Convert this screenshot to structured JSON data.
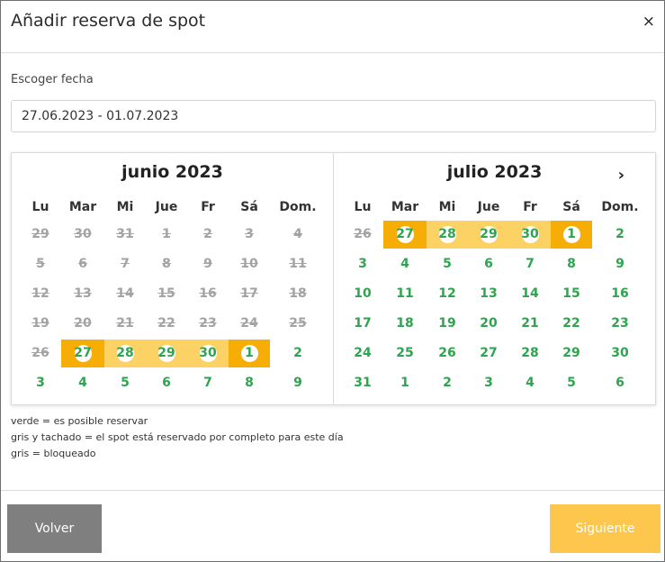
{
  "modal": {
    "title": "Añadir reserva de spot",
    "close_icon": "×"
  },
  "date_field": {
    "label": "Escoger fecha",
    "value": "27.06.2023 - 01.07.2023"
  },
  "calendar": {
    "weekdays": [
      "Lu",
      "Mar",
      "Mi",
      "Jue",
      "Fr",
      "Sá",
      "Dom."
    ],
    "next_icon": "›",
    "colors": {
      "available": "#2ea44f",
      "unavailable": "#a3a3a3",
      "range": "#fdd265",
      "range_end": "#f6ae06"
    },
    "months": [
      {
        "title": "junio 2023",
        "weeks": [
          [
            {
              "d": "29",
              "s": "gray"
            },
            {
              "d": "30",
              "s": "gray"
            },
            {
              "d": "31",
              "s": "gray"
            },
            {
              "d": "1",
              "s": "gray"
            },
            {
              "d": "2",
              "s": "gray"
            },
            {
              "d": "3",
              "s": "gray"
            },
            {
              "d": "4",
              "s": "gray"
            }
          ],
          [
            {
              "d": "5",
              "s": "gray"
            },
            {
              "d": "6",
              "s": "gray"
            },
            {
              "d": "7",
              "s": "gray"
            },
            {
              "d": "8",
              "s": "gray"
            },
            {
              "d": "9",
              "s": "gray"
            },
            {
              "d": "10",
              "s": "gray"
            },
            {
              "d": "11",
              "s": "gray"
            }
          ],
          [
            {
              "d": "12",
              "s": "gray"
            },
            {
              "d": "13",
              "s": "gray"
            },
            {
              "d": "14",
              "s": "gray"
            },
            {
              "d": "15",
              "s": "gray"
            },
            {
              "d": "16",
              "s": "gray"
            },
            {
              "d": "17",
              "s": "gray"
            },
            {
              "d": "18",
              "s": "gray"
            }
          ],
          [
            {
              "d": "19",
              "s": "gray"
            },
            {
              "d": "20",
              "s": "gray"
            },
            {
              "d": "21",
              "s": "gray"
            },
            {
              "d": "22",
              "s": "gray"
            },
            {
              "d": "23",
              "s": "gray"
            },
            {
              "d": "24",
              "s": "gray"
            },
            {
              "d": "25",
              "s": "gray"
            }
          ],
          [
            {
              "d": "26",
              "s": "gray"
            },
            {
              "d": "27",
              "s": "green",
              "r": "start"
            },
            {
              "d": "28",
              "s": "green",
              "r": "mid"
            },
            {
              "d": "29",
              "s": "green",
              "r": "mid"
            },
            {
              "d": "30",
              "s": "green",
              "r": "mid"
            },
            {
              "d": "1",
              "s": "green",
              "r": "end"
            },
            {
              "d": "2",
              "s": "green"
            }
          ],
          [
            {
              "d": "3",
              "s": "green"
            },
            {
              "d": "4",
              "s": "green"
            },
            {
              "d": "5",
              "s": "green"
            },
            {
              "d": "6",
              "s": "green"
            },
            {
              "d": "7",
              "s": "green"
            },
            {
              "d": "8",
              "s": "green"
            },
            {
              "d": "9",
              "s": "green"
            }
          ]
        ]
      },
      {
        "title": "julio 2023",
        "weeks": [
          [
            {
              "d": "26",
              "s": "gray"
            },
            {
              "d": "27",
              "s": "green",
              "r": "start"
            },
            {
              "d": "28",
              "s": "green",
              "r": "mid"
            },
            {
              "d": "29",
              "s": "green",
              "r": "mid"
            },
            {
              "d": "30",
              "s": "green",
              "r": "mid"
            },
            {
              "d": "1",
              "s": "green",
              "r": "end"
            },
            {
              "d": "2",
              "s": "green"
            }
          ],
          [
            {
              "d": "3",
              "s": "green"
            },
            {
              "d": "4",
              "s": "green"
            },
            {
              "d": "5",
              "s": "green"
            },
            {
              "d": "6",
              "s": "green"
            },
            {
              "d": "7",
              "s": "green"
            },
            {
              "d": "8",
              "s": "green"
            },
            {
              "d": "9",
              "s": "green"
            }
          ],
          [
            {
              "d": "10",
              "s": "green"
            },
            {
              "d": "11",
              "s": "green"
            },
            {
              "d": "12",
              "s": "green"
            },
            {
              "d": "13",
              "s": "green"
            },
            {
              "d": "14",
              "s": "green"
            },
            {
              "d": "15",
              "s": "green"
            },
            {
              "d": "16",
              "s": "green"
            }
          ],
          [
            {
              "d": "17",
              "s": "green"
            },
            {
              "d": "18",
              "s": "green"
            },
            {
              "d": "19",
              "s": "green"
            },
            {
              "d": "20",
              "s": "green"
            },
            {
              "d": "21",
              "s": "green"
            },
            {
              "d": "22",
              "s": "green"
            },
            {
              "d": "23",
              "s": "green"
            }
          ],
          [
            {
              "d": "24",
              "s": "green"
            },
            {
              "d": "25",
              "s": "green"
            },
            {
              "d": "26",
              "s": "green"
            },
            {
              "d": "27",
              "s": "green"
            },
            {
              "d": "28",
              "s": "green"
            },
            {
              "d": "29",
              "s": "green"
            },
            {
              "d": "30",
              "s": "green"
            }
          ],
          [
            {
              "d": "31",
              "s": "green"
            },
            {
              "d": "1",
              "s": "green"
            },
            {
              "d": "2",
              "s": "green"
            },
            {
              "d": "3",
              "s": "green"
            },
            {
              "d": "4",
              "s": "green"
            },
            {
              "d": "5",
              "s": "green"
            },
            {
              "d": "6",
              "s": "green"
            }
          ]
        ]
      }
    ]
  },
  "legend": [
    "verde = es posible reservar",
    "gris y tachado = el spot está reservado por completo para este día",
    "gris = bloqueado"
  ],
  "footer": {
    "back_label": "Volver",
    "next_label": "Siguiente"
  }
}
